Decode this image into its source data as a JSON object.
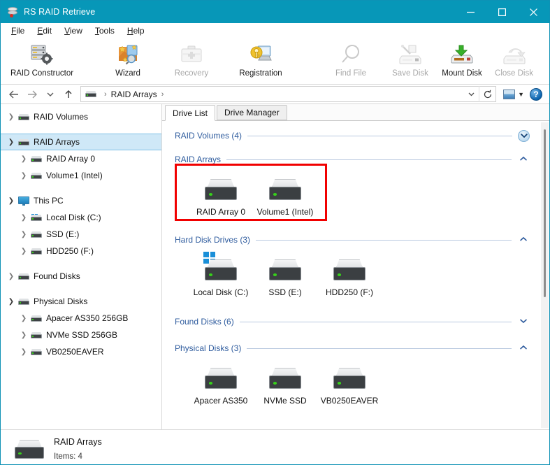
{
  "window": {
    "title": "RS RAID Retrieve",
    "icon": "raid-app-icon",
    "controls": {
      "minimize": "minimize-icon",
      "maximize": "maximize-icon",
      "close": "close-icon"
    },
    "accent_color": "#0797b8"
  },
  "menubar": {
    "items": [
      {
        "label": "File",
        "accel": "F"
      },
      {
        "label": "Edit",
        "accel": "E"
      },
      {
        "label": "View",
        "accel": "V"
      },
      {
        "label": "Tools",
        "accel": "T"
      },
      {
        "label": "Help",
        "accel": "H"
      }
    ]
  },
  "toolbar": {
    "left": [
      {
        "label": "RAID Constructor",
        "icon": "raid-constructor-icon",
        "enabled": true
      },
      {
        "label": "Wizard",
        "icon": "wizard-icon",
        "enabled": true
      },
      {
        "label": "Recovery",
        "icon": "recovery-kit-icon",
        "enabled": false
      },
      {
        "label": "Registration",
        "icon": "registration-key-icon",
        "enabled": true
      },
      {
        "label": "Find File",
        "icon": "magnifier-icon",
        "enabled": false
      }
    ],
    "right": [
      {
        "label": "Save Disk",
        "icon": "save-disk-icon",
        "enabled": false
      },
      {
        "label": "Mount Disk",
        "icon": "mount-disk-icon",
        "enabled": true
      },
      {
        "label": "Close Disk",
        "icon": "close-disk-icon",
        "enabled": false
      }
    ]
  },
  "addressbar": {
    "back": "back-arrow-icon",
    "forward": "forward-arrow-icon",
    "history": "history-chevron-icon",
    "up": "up-arrow-icon",
    "crumb_icon": "drive-icon",
    "crumb": "RAID Arrays",
    "crumb_sep": "›",
    "dropdown": "chevron-down-icon",
    "refresh": "refresh-icon",
    "view_mode": "view-mode-icon",
    "view_caret": "chevron-down-icon",
    "help": "?"
  },
  "tree": {
    "groups": [
      {
        "nodes": [
          {
            "label": "RAID Volumes",
            "icon": "drive-icon",
            "expander": "collapsed",
            "indent": 0,
            "selected": false
          }
        ]
      },
      {
        "nodes": [
          {
            "label": "RAID Arrays",
            "icon": "drive-icon",
            "expander": "expanded",
            "indent": 0,
            "selected": true
          },
          {
            "label": "RAID Array  0",
            "icon": "drive-icon",
            "expander": "collapsed",
            "indent": 1,
            "selected": false
          },
          {
            "label": "Volume1 (Intel)",
            "icon": "drive-icon",
            "expander": "collapsed",
            "indent": 1,
            "selected": false
          }
        ]
      },
      {
        "nodes": [
          {
            "label": "This PC",
            "icon": "this-pc-icon",
            "expander": "expanded",
            "indent": 0,
            "selected": false
          },
          {
            "label": "Local Disk (C:)",
            "icon": "windows-drive-icon",
            "expander": "collapsed",
            "indent": 1,
            "selected": false
          },
          {
            "label": "SSD (E:)",
            "icon": "drive-icon",
            "expander": "collapsed",
            "indent": 1,
            "selected": false
          },
          {
            "label": "HDD250 (F:)",
            "icon": "drive-icon",
            "expander": "collapsed",
            "indent": 1,
            "selected": false
          }
        ]
      },
      {
        "nodes": [
          {
            "label": "Found Disks",
            "icon": "drive-icon",
            "expander": "collapsed",
            "indent": 0,
            "selected": false
          }
        ]
      },
      {
        "nodes": [
          {
            "label": "Physical Disks",
            "icon": "drive-icon",
            "expander": "expanded",
            "indent": 0,
            "selected": false
          },
          {
            "label": "Apacer AS350 256GB",
            "icon": "drive-icon",
            "expander": "collapsed",
            "indent": 1,
            "selected": false
          },
          {
            "label": "NVMe SSD 256GB",
            "icon": "drive-icon",
            "expander": "collapsed",
            "indent": 1,
            "selected": false
          },
          {
            "label": "VB0250EAVER",
            "icon": "drive-icon",
            "expander": "collapsed",
            "indent": 1,
            "selected": false
          }
        ]
      }
    ]
  },
  "tabs": [
    {
      "label": "Drive List",
      "active": true
    },
    {
      "label": "Drive Manager",
      "active": false
    }
  ],
  "sections": [
    {
      "title": "RAID Volumes (4)",
      "chevron": "chevron-down-circled-icon",
      "expanded": false,
      "items": []
    },
    {
      "title": "RAID Arrays",
      "chevron": "chevron-up-icon",
      "expanded": true,
      "highlighted": true,
      "items": [
        {
          "label": "RAID Array  0",
          "icon": "drive-icon"
        },
        {
          "label": "Volume1 (Intel)",
          "icon": "drive-icon"
        }
      ]
    },
    {
      "title": "Hard Disk Drives (3)",
      "chevron": "chevron-up-icon",
      "expanded": true,
      "items": [
        {
          "label": "Local Disk (C:)",
          "icon": "windows-drive-icon"
        },
        {
          "label": "SSD (E:)",
          "icon": "drive-icon"
        },
        {
          "label": "HDD250 (F:)",
          "icon": "drive-icon"
        }
      ]
    },
    {
      "title": "Found Disks (6)",
      "chevron": "chevron-down-icon",
      "expanded": false,
      "items": []
    },
    {
      "title": "Physical Disks (3)",
      "chevron": "chevron-up-icon",
      "expanded": true,
      "items": [
        {
          "label": "Apacer AS350",
          "icon": "drive-icon"
        },
        {
          "label": "NVMe SSD",
          "icon": "drive-icon"
        },
        {
          "label": "VB0250EAVER",
          "icon": "drive-icon"
        }
      ]
    }
  ],
  "annotation": {
    "color": "#f10000",
    "target_section": "RAID Arrays"
  },
  "statusbar": {
    "icon": "drive-icon",
    "title": "RAID Arrays",
    "detail": "Items: 4"
  }
}
